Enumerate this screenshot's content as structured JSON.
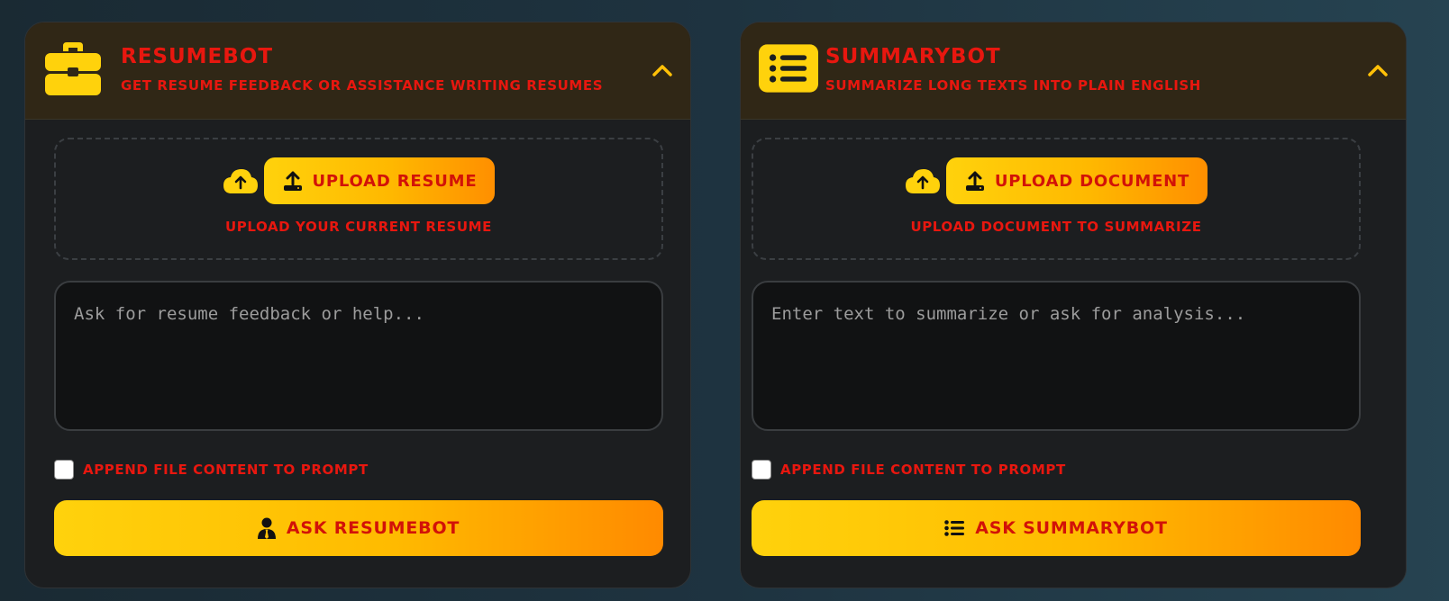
{
  "colors": {
    "accent_yellow": "#FFD20C",
    "accent_orange": "#FF8A00",
    "text_red": "#E8170F",
    "panel_bg": "#1C1E20",
    "header_bg": "#302716"
  },
  "panels": [
    {
      "title": "ResumeBot",
      "subtitle": "Get resume feedback or assistance writing resumes",
      "icon": "briefcase-icon",
      "upload_button_label": "Upload Resume",
      "upload_hint": "Upload your current resume",
      "prompt_placeholder": "Ask for resume feedback or help...",
      "append_label": "Append file content to prompt",
      "ask_button_label": "Ask ResumeBot",
      "ask_icon": "user-tie-icon"
    },
    {
      "title": "SummaryBot",
      "subtitle": "Summarize long texts into plain English",
      "icon": "list-icon",
      "upload_button_label": "Upload Document",
      "upload_hint": "Upload document to summarize",
      "prompt_placeholder": "Enter text to summarize or ask for analysis...",
      "append_label": "Append file content to prompt",
      "ask_button_label": "Ask SummaryBot",
      "ask_icon": "list-icon"
    }
  ]
}
